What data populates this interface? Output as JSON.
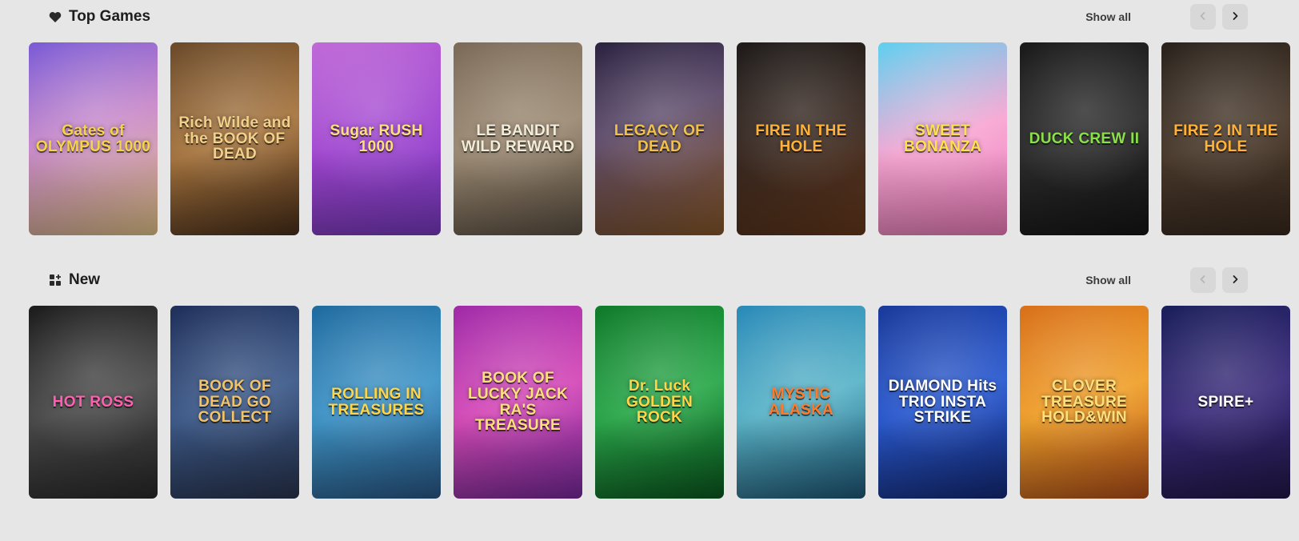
{
  "top_games": {
    "title": "Top Games",
    "icon": "heart-icon",
    "show_all_label": "Show all",
    "games": [
      {
        "name": "Gates of OLYMPUS 1000",
        "bg": "linear-gradient(160deg,#7a5bd6 0%,#c889c9 45%,#e8c88a 100%)",
        "color": "#f7d34a"
      },
      {
        "name": "Rich Wilde and the BOOK OF DEAD",
        "bg": "linear-gradient(160deg,#6b4a2a 0%,#a8763f 50%,#4a2f1a 100%)",
        "color": "#f1d08a"
      },
      {
        "name": "Sugar RUSH 1000",
        "bg": "linear-gradient(160deg,#c06ad8 0%,#9f45d0 50%,#7a3bc4 100%)",
        "color": "#ffe07a"
      },
      {
        "name": "LE BANDIT WILD REWARD",
        "bg": "linear-gradient(160deg,#7b6a57 0%,#9c8a73 50%,#5e5244 100%)",
        "color": "#f2ecd8"
      },
      {
        "name": "LEGACY OF DEAD",
        "bg": "linear-gradient(160deg,#2b2340 0%,#5c4a6a 40%,#8a5a2a 100%)",
        "color": "#f0c24a"
      },
      {
        "name": "FIRE IN THE HOLE",
        "bg": "linear-gradient(160deg,#1f1b1a 0%,#3a2a22 50%,#6a3a1c 100%)",
        "color": "#ffb23a"
      },
      {
        "name": "SWEET BONANZA",
        "bg": "linear-gradient(160deg,#5fd0f0 0%,#f7a6d2 50%,#f47fbf 100%)",
        "color": "#ffe14d"
      },
      {
        "name": "DUCK CREW II",
        "bg": "linear-gradient(160deg,#1b1b1b 0%,#2c2c2c 50%,#151515 100%)",
        "color": "#8be04a"
      },
      {
        "name": "FIRE 2 IN THE HOLE",
        "bg": "linear-gradient(160deg,#2a221c 0%,#4a3a2c 50%,#3a2a1e 100%)",
        "color": "#ffb23a"
      }
    ]
  },
  "new_games": {
    "title": "New",
    "icon": "grid-plus-icon",
    "show_all_label": "Show all",
    "games": [
      {
        "name": "HOT ROSS",
        "bg": "linear-gradient(160deg,#1c1c1c 0%,#4a4a4a 50%,#2a2a2a 100%)",
        "color": "#ff5fb0"
      },
      {
        "name": "BOOK OF DEAD GO COLLECT",
        "bg": "linear-gradient(160deg,#1e2f5a 0%,#3d5a8a 50%,#2a3550 100%)",
        "color": "#f1c36a"
      },
      {
        "name": "ROLLING IN TREASURES",
        "bg": "linear-gradient(160deg,#1f6a9f 0%,#3f95c8 50%,#2a5a8a 100%)",
        "color": "#ffd54a"
      },
      {
        "name": "BOOK OF LUCKY JACK RA'S TREASURE",
        "bg": "linear-gradient(160deg,#a02aa8 0%,#d54ab8 50%,#7a2aa0 100%)",
        "color": "#ffe07a"
      },
      {
        "name": "Dr. Luck GOLDEN ROCK",
        "bg": "linear-gradient(160deg,#0f7a2a 0%,#2aa84a 50%,#0a5a1f 100%)",
        "color": "#ffd54a"
      },
      {
        "name": "MYSTIC ALASKA",
        "bg": "linear-gradient(160deg,#2a8ab8 0%,#5ab4c8 50%,#1f5a7a 100%)",
        "color": "#ff7a2a"
      },
      {
        "name": "DIAMOND Hits TRIO INSTA STRIKE",
        "bg": "linear-gradient(160deg,#1a3a9a 0%,#2a5ad0 50%,#142a7a 100%)",
        "color": "#ffffff"
      },
      {
        "name": "CLOVER TREASURE HOLD&WIN",
        "bg": "linear-gradient(160deg,#d8701a 0%,#f0a02a 50%,#b8501a 100%)",
        "color": "#ffe07a"
      },
      {
        "name": "SPIRE+",
        "bg": "linear-gradient(160deg,#1a1f5a 0%,#3a2a7a 50%,#22184a 100%)",
        "color": "#ffffff"
      }
    ]
  }
}
